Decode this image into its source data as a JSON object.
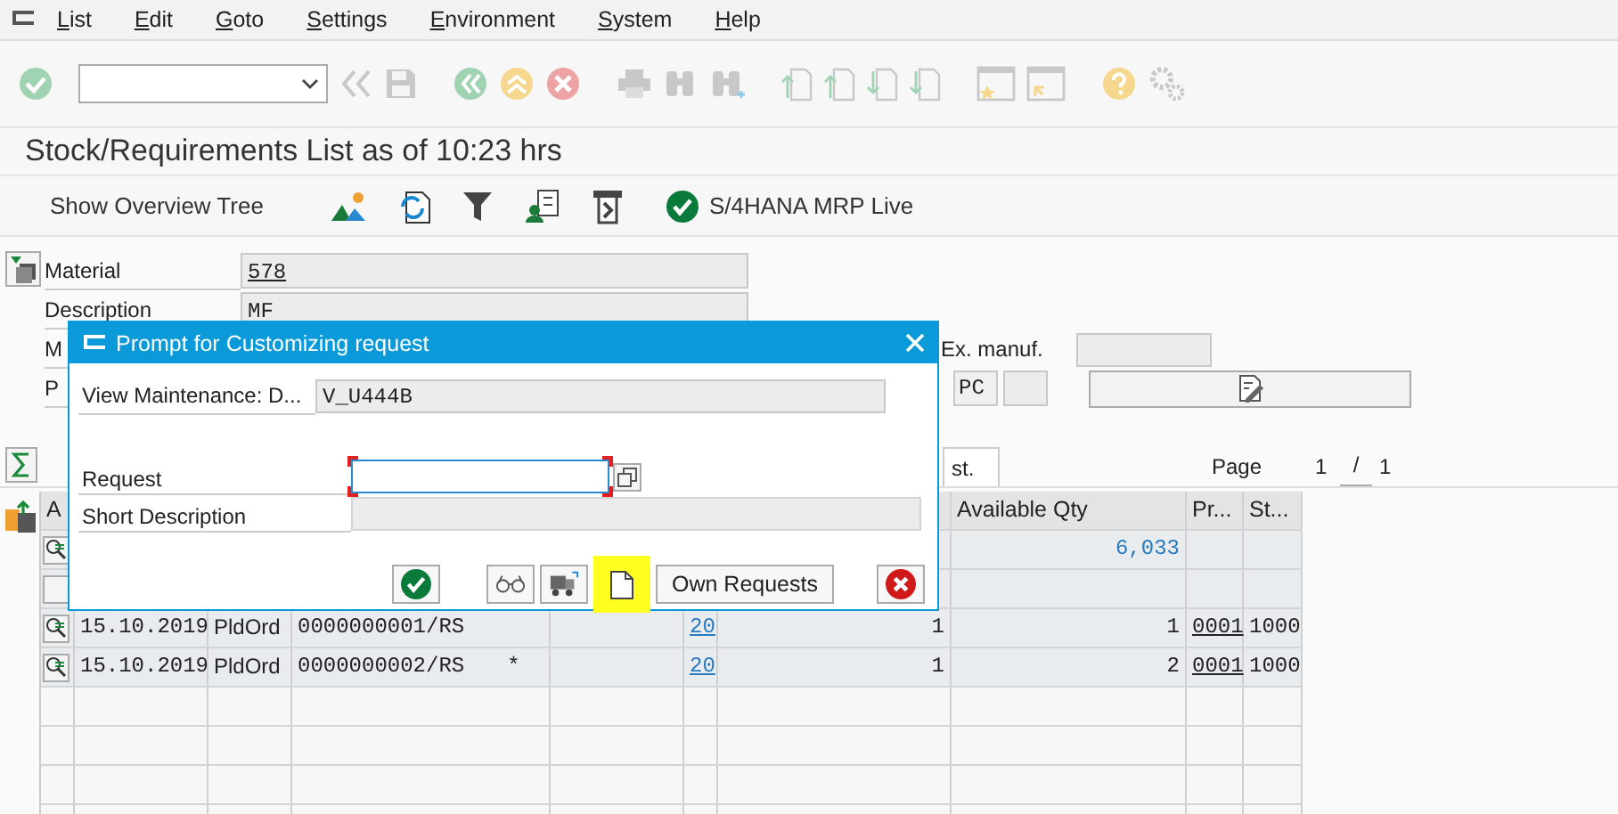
{
  "menu_bar": [
    {
      "label": "List"
    },
    {
      "label": "Edit"
    },
    {
      "label": "Goto"
    },
    {
      "label": "Settings"
    },
    {
      "label": "Environment"
    },
    {
      "label": "System"
    },
    {
      "label": "Help"
    }
  ],
  "title": "Stock/Requirements List as of 10:23 hrs",
  "app_toolbar": {
    "overview_button": "Show Overview Tree",
    "mrp_live_button": "S/4HANA MRP Live"
  },
  "header": {
    "fields": [
      {
        "label": "Material",
        "value": "578"
      },
      {
        "label": "Description",
        "value": "MF"
      }
    ],
    "row_3_label": "M",
    "ex_manuf_label": "Ex. manuf.",
    "row_4_label": "P",
    "unit": "PC"
  },
  "tab": {
    "label": "st.",
    "selected": true
  },
  "pagination": {
    "label": "Page",
    "current": "1",
    "separator": "/",
    "total": "1"
  },
  "table": {
    "columns": [
      "A",
      "Available Qty",
      "Pr...",
      "St..."
    ],
    "rows": [
      {
        "kind": "total",
        "available_qty": "6,033"
      },
      {
        "kind": "blank"
      },
      {
        "kind": "order",
        "date": "15.10.2019",
        "mrp_element": "PldOrd",
        "element_data": "0000000001/RS",
        "column_5": "20",
        "column_6": "1",
        "available_qty": "1",
        "pr": "0001",
        "st": "1000"
      },
      {
        "kind": "order",
        "date": "15.10.2019",
        "mrp_element": "PldOrd",
        "element_data": "0000000002/RS",
        "flag": "*",
        "column_5": "20",
        "column_6": "1",
        "available_qty": "2",
        "pr": "0001",
        "st": "1000"
      }
    ]
  },
  "dialog": {
    "title": "Prompt for Customizing request",
    "view_label": "View Maintenance: D...",
    "view_value": "V_U444B",
    "request_label": "Request",
    "request_required": true,
    "short_description_label": "Short Description",
    "buttons": [
      {
        "kind": "confirm",
        "highlighted": false
      },
      {
        "kind": "display",
        "highlighted": false
      },
      {
        "kind": "transport",
        "highlighted": false
      },
      {
        "kind": "create",
        "highlighted": true
      },
      {
        "kind": "text",
        "label": "Own Requests",
        "highlighted": false
      },
      {
        "kind": "cancel",
        "highlighted": false
      }
    ]
  }
}
